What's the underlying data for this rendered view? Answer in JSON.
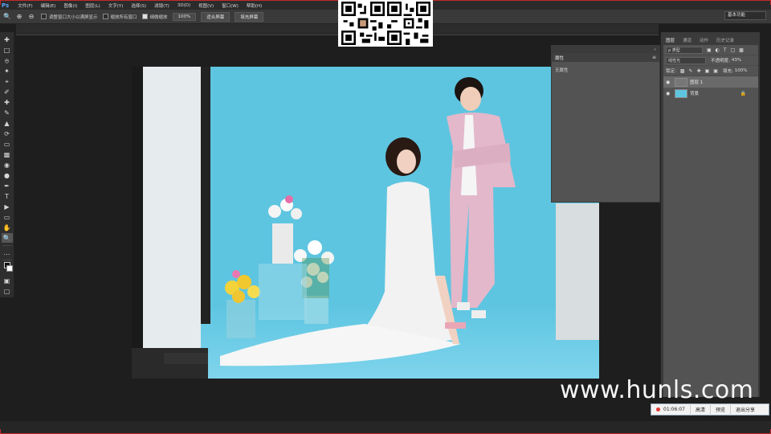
{
  "app": {
    "logo": "Ps"
  },
  "menu": [
    "文件(F)",
    "编辑(E)",
    "图像(I)",
    "图层(L)",
    "文字(Y)",
    "选择(S)",
    "滤镜(T)",
    "3D(D)",
    "视图(V)",
    "窗口(W)",
    "帮助(H)"
  ],
  "options": {
    "resize_window": "调整窗口大小以满屏显示",
    "zoom_all": "缩放所有窗口",
    "scrubby_zoom": "细微缩放",
    "zoom_level": "100%",
    "fit_screen": "适合屏幕",
    "fill_screen": "填充屏幕",
    "workspace": "基本功能"
  },
  "properties": {
    "tab": "属性",
    "empty_text": "无属性"
  },
  "layers": {
    "tabs": [
      "图层",
      "通道",
      "动作",
      "历史记录"
    ],
    "filter_kind": "ρ 类型",
    "blend_mode": "线性光",
    "opacity_label": "不透明度:",
    "opacity_value": "43%",
    "lock_label": "锁定:",
    "fill_label": "填充:",
    "fill_value": "100%",
    "items": [
      {
        "name": "图层 1"
      },
      {
        "name": "背景"
      }
    ]
  },
  "watermark": "www.hunls.com",
  "recording": {
    "time": "01:06:07",
    "hd": "高清",
    "preview": "预览",
    "exit": "退出分享"
  },
  "colors": {
    "accent_red": "#c62828",
    "panel_bg": "#535353",
    "backdrop": "#5ec5e0"
  }
}
